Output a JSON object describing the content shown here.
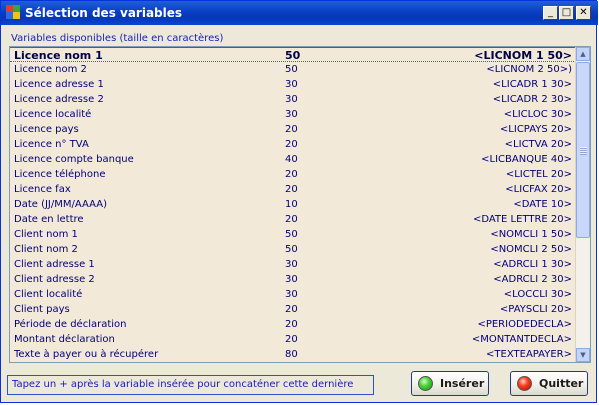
{
  "window": {
    "title": "Sélection des variables",
    "controls": {
      "minimize": "_",
      "maximize": "□",
      "close": "✕"
    }
  },
  "caption": "Variables disponibles (taille en caractères)",
  "selected_index": 0,
  "variables": [
    {
      "name": "Licence nom 1",
      "size": "50",
      "code": "<LICNOM 1 50>"
    },
    {
      "name": "Licence nom 2",
      "size": "50",
      "code": "<LICNOM 2 50>)"
    },
    {
      "name": "Licence adresse 1",
      "size": "30",
      "code": "<LICADR 1 30>"
    },
    {
      "name": "Licence adresse 2",
      "size": "30",
      "code": "<LICADR 2 30>"
    },
    {
      "name": "Licence localité",
      "size": "30",
      "code": "<LICLOC 30>"
    },
    {
      "name": "Licence pays",
      "size": "20",
      "code": "<LICPAYS 20>"
    },
    {
      "name": "Licence n° TVA",
      "size": "20",
      "code": "<LICTVA 20>"
    },
    {
      "name": "Licence compte banque",
      "size": "40",
      "code": "<LICBANQUE 40>"
    },
    {
      "name": "Licence téléphone",
      "size": "20",
      "code": "<LICTEL 20>"
    },
    {
      "name": "Licence fax",
      "size": "20",
      "code": "<LICFAX 20>"
    },
    {
      "name": "Date (JJ/MM/AAAA)",
      "size": "10",
      "code": "<DATE 10>"
    },
    {
      "name": "Date en lettre",
      "size": "20",
      "code": "<DATE LETTRE 20>"
    },
    {
      "name": "Client nom 1",
      "size": "50",
      "code": "<NOMCLI 1 50>"
    },
    {
      "name": "Client nom 2",
      "size": "50",
      "code": "<NOMCLI 2 50>"
    },
    {
      "name": "Client adresse 1",
      "size": "30",
      "code": "<ADRCLI 1 30>"
    },
    {
      "name": "Client adresse 2",
      "size": "30",
      "code": "<ADRCLI 2 30>"
    },
    {
      "name": "Client localité",
      "size": "30",
      "code": "<LOCCLI 30>"
    },
    {
      "name": "Client pays",
      "size": "20",
      "code": "<PAYSCLI 20>"
    },
    {
      "name": "Période de déclaration",
      "size": "20",
      "code": "<PERIODEDECLA>"
    },
    {
      "name": "Montant déclaration",
      "size": "20",
      "code": "<MONTANTDECLA>"
    },
    {
      "name": "Texte à payer ou à récupérer",
      "size": "80",
      "code": "<TEXTEAPAYER>"
    }
  ],
  "hint": "Tapez un + après la variable insérée pour concaténer cette dernière",
  "buttons": {
    "insert": "Insérer",
    "quit": "Quitter"
  },
  "colors": {
    "title_bar": "#0a3fc2",
    "list_background": "#f3e9d8",
    "list_text": "#00007a",
    "insert_led": "#4fd33b",
    "quit_led": "#ff3b1d"
  }
}
